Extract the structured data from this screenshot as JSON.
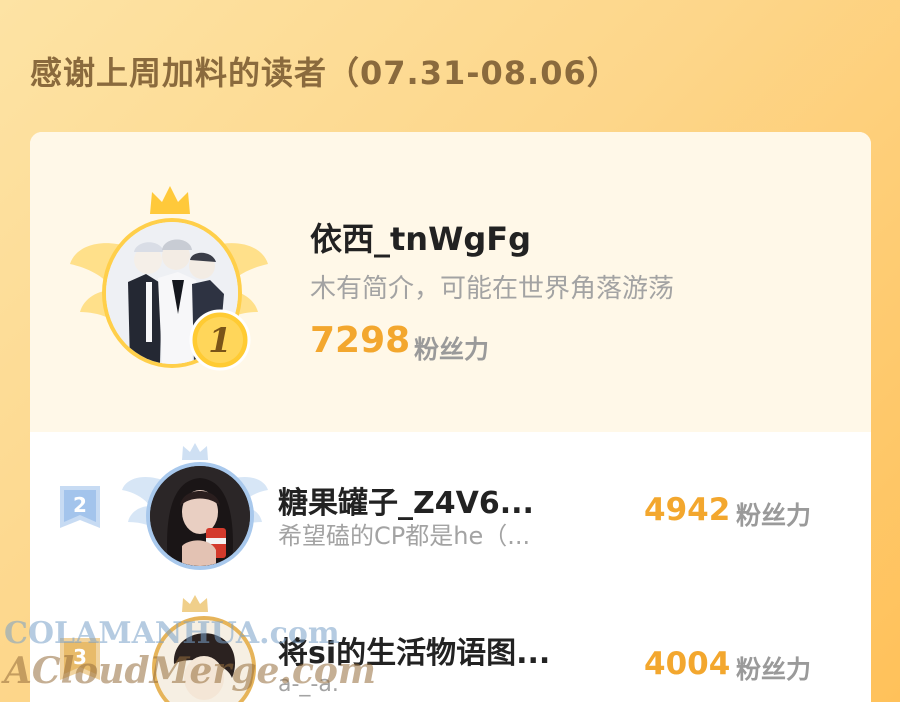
{
  "heading": "感谢上周加料的读者（07.31-08.06）",
  "unit_label": "粉丝力",
  "readers": [
    {
      "rank": "1",
      "name": "依西_tnWgFg",
      "bio": "木有简介，可能在世界角落游荡",
      "score": "7298"
    },
    {
      "rank": "2",
      "name": "糖果罐子_Z4V6...",
      "bio": "希望磕的CP都是he（...",
      "score": "4942"
    },
    {
      "rank": "3",
      "name": "将si的生活物语图...",
      "bio": "a-_-a.",
      "score": "4004"
    }
  ],
  "watermark": {
    "line1": "COLAMANHUA.com",
    "line2": "ACloudMerge.com"
  },
  "colors": {
    "accent": "#f3a72e",
    "gold": "#ffcf4a",
    "silver": "#a8c8ec",
    "bronze": "#e6b45a"
  }
}
